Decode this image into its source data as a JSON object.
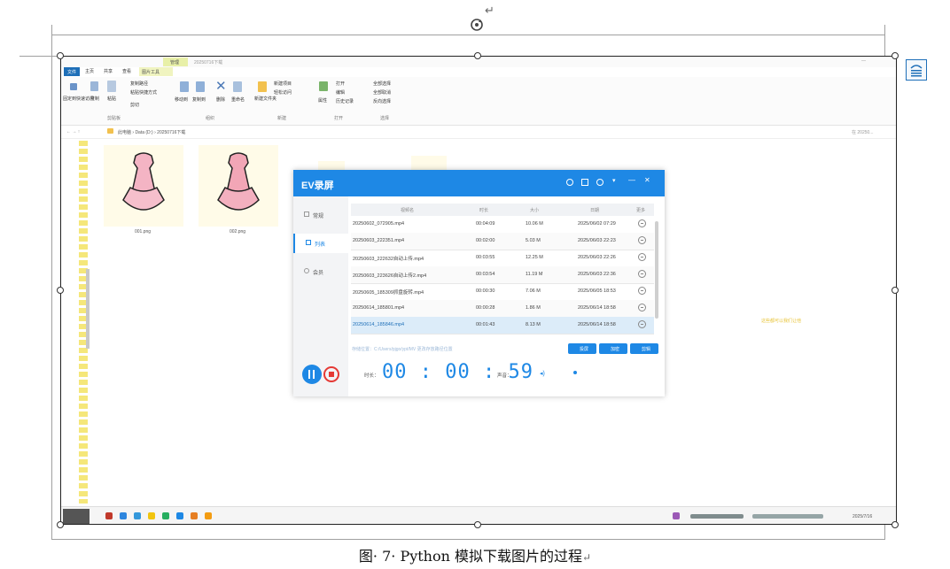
{
  "document": {
    "caption": "图· 7· Python 模拟下载图片的过程",
    "return_mark": "↵"
  },
  "explorer": {
    "window_title": "20250716下载",
    "manage_tab": "管理",
    "tabs": [
      "文件",
      "主页",
      "共享",
      "查看",
      "图片工具"
    ],
    "ribbon": {
      "pin_label": "固定到快速访问",
      "copy_label": "复制",
      "paste_label": "粘贴",
      "copy_path": "复制路径",
      "paste_shortcut": "粘贴快捷方式",
      "cut": "剪切",
      "clipboard_group": "剪贴板",
      "move_to": "移动到",
      "copy_to": "复制到",
      "delete": "删除",
      "rename": "重命名",
      "organize_group": "组织",
      "new_item": "新建项目",
      "easy_access": "轻松访问",
      "new_folder": "新建文件夹",
      "new_group": "新建",
      "properties": "属性",
      "open": "打开",
      "edit": "编辑",
      "history": "历史记录",
      "open_group": "打开",
      "select_all": "全部选择",
      "select_none": "全部取消",
      "invert": "反向选择",
      "select_group": "选择"
    },
    "breadcrumb": "此电脑 › Data (D:) › 20250716下载",
    "search_placeholder": "在 20250...",
    "files": [
      {
        "name": "001.png"
      },
      {
        "name": "002.png"
      }
    ],
    "side_note": "这些都可以我们让他"
  },
  "ev_recorder": {
    "title": "EV录屏",
    "sidebar": [
      {
        "label": "常规",
        "icon": "grid-icon"
      },
      {
        "label": "列表",
        "icon": "list-icon"
      },
      {
        "label": "会员",
        "icon": "star-icon"
      }
    ],
    "table": {
      "headers": [
        "视频名",
        "时长",
        "大小",
        "日期",
        "更多"
      ],
      "rows": [
        {
          "name": "20250602_072905.mp4",
          "duration": "00:04:09",
          "size": "10.06 M",
          "date": "2025/06/02 07:29"
        },
        {
          "name": "20250603_222351.mp4",
          "duration": "00:02:00",
          "size": "5.03 M",
          "date": "2025/06/03 22:23"
        },
        {
          "name": "20250603_222632自动上传.mp4",
          "duration": "00:03:55",
          "size": "12.25 M",
          "date": "2025/06/03 22:26"
        },
        {
          "name": "20250603_223626自动上传2.mp4",
          "duration": "00:03:54",
          "size": "11.19 M",
          "date": "2025/06/03 22:36"
        },
        {
          "name": "20250605_185309抓盘旋转.mp4",
          "duration": "00:00:30",
          "size": "7.06 M",
          "date": "2025/06/05 18:53"
        },
        {
          "name": "20250614_185801.mp4",
          "duration": "00:00:28",
          "size": "1.86 M",
          "date": "2025/06/14 18:58"
        },
        {
          "name": "20250614_185846.mp4",
          "duration": "00:01:43",
          "size": "8.13 M",
          "date": "2025/06/14 18:58"
        }
      ]
    },
    "save_path": "存储位置：C:/Users/pjgo/ypt/MV 更改存放路径位置",
    "buttons": [
      "投屏",
      "加密",
      "剪辑"
    ],
    "timer_label": "时长：",
    "timer": "00 : 00 : 59",
    "sound_label": "声音："
  },
  "taskbar": {
    "date": "2025/7/16"
  },
  "colors": {
    "ev_blue": "#1e88e5",
    "selected_row": "#dcecf9",
    "record_red": "#e53935"
  }
}
